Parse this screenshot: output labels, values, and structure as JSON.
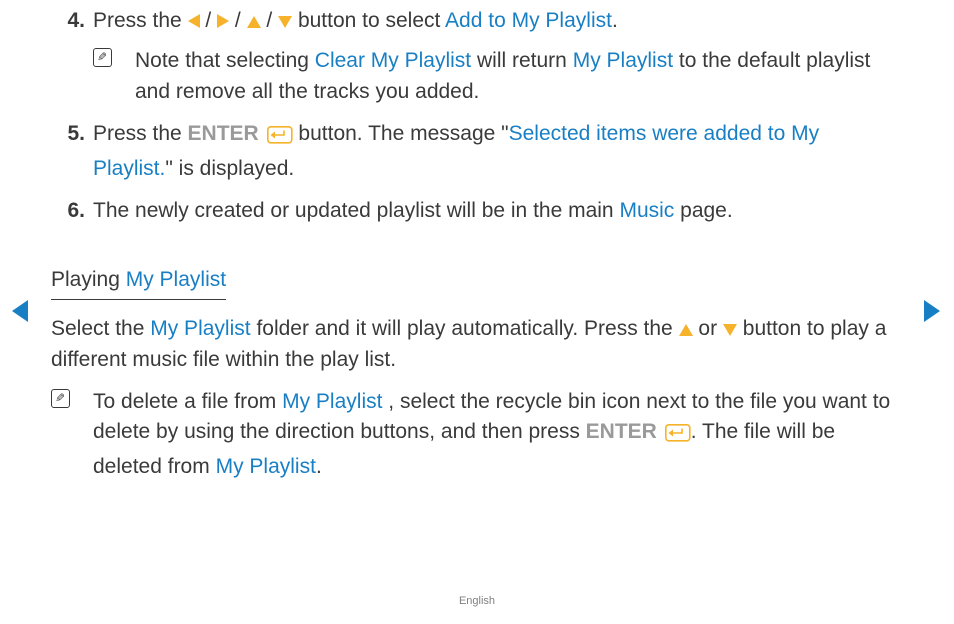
{
  "steps": {
    "s4": {
      "num": "4.",
      "t1": "Press the ",
      "t2": " / ",
      "t3": " / ",
      "t4": " / ",
      "t5": " button to select ",
      "highlight": "Add to My Playlist",
      "t6": ".",
      "note_t1": "Note that selecting ",
      "note_h1": "Clear My Playlist",
      "note_t2": " will return ",
      "note_h2": "My Playlist",
      "note_t3": " to the default playlist and remove all the tracks you added."
    },
    "s5": {
      "num": "5.",
      "t1": "Press the ",
      "enter": "ENTER",
      "t2": " button. The message \"",
      "highlight": "Selected items were added to My Playlist.",
      "t3": "\" is displayed."
    },
    "s6": {
      "num": "6.",
      "t1": "The newly created or updated playlist will be in the main ",
      "highlight": "Music",
      "t2": " page."
    }
  },
  "section": {
    "heading_t1": "Playing ",
    "heading_h": "My Playlist",
    "p1_t1": "Select the ",
    "p1_h1": "My Playlist",
    "p1_t2": " folder and it will play automatically. Press the ",
    "p1_t3": " or ",
    "p1_t4": " button to play a different music file within the play list.",
    "note_t1": "To delete a file from ",
    "note_h1": "My Playlist",
    "note_t2": ", select the recycle bin icon next to the file you want to delete by using the direction buttons, and then press ",
    "note_enter": "ENTER",
    "note_t3": ". The file will be deleted from ",
    "note_h2": "My Playlist",
    "note_t4": "."
  },
  "footer": "English",
  "colors": {
    "accent": "#f6b22a",
    "nav": "#197fc4"
  }
}
